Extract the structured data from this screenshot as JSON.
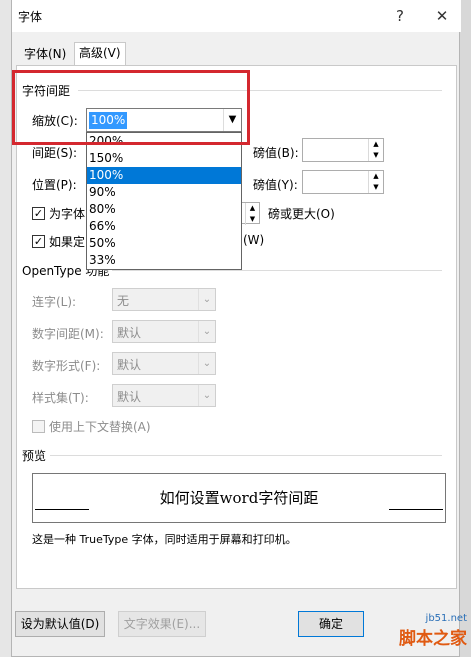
{
  "dialog": {
    "title": "字体",
    "help_icon_char": "?",
    "close_icon_char": "✕"
  },
  "tabs": [
    {
      "label": "字体(N)",
      "active": false
    },
    {
      "label": "高级(V)",
      "active": true
    }
  ],
  "spacing": {
    "section_title": "字符间距",
    "scale_label": "缩放(C):",
    "scale_value": "100%",
    "dropdown_options": [
      "200%",
      "150%",
      "100%",
      "90%",
      "80%",
      "66%",
      "50%",
      "33%"
    ],
    "dropdown_selected": "100%",
    "spacing_label": "间距(S):",
    "spacing_by_label": "磅值(B):",
    "position_label": "位置(P):",
    "position_by_label": "磅值(Y):",
    "kerning_label": "为字体",
    "kerning_suffix": "磅或更大(O)",
    "grid_label": "如果定",
    "grid_suffix": "(W)"
  },
  "opentype": {
    "section_title": "OpenType 功能",
    "ligatures_label": "连字(L):",
    "ligatures_value": "无",
    "num_spacing_label": "数字间距(M):",
    "num_spacing_value": "默认",
    "num_forms_label": "数字形式(F):",
    "num_forms_value": "默认",
    "stylistic_label": "样式集(T):",
    "stylistic_value": "默认",
    "contextual_label": "使用上下文替换(A)"
  },
  "preview": {
    "section_title": "预览",
    "sample_text": "如何设置word字符间距",
    "note": "这是一种 TrueType 字体，同时适用于屏幕和打印机。"
  },
  "buttons": {
    "set_default": "设为默认值(D)",
    "text_effects": "文字效果(E)...",
    "ok": "确定"
  },
  "watermark": {
    "site": "jb51.net",
    "brand": "脚本之家"
  },
  "colors": {
    "highlight_box": "#d4282f",
    "selection": "#0078d7"
  }
}
